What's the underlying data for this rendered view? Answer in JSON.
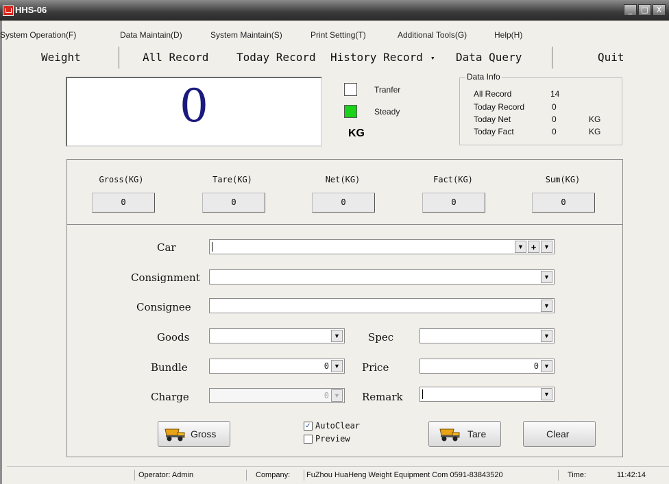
{
  "window": {
    "title": "HHS-06",
    "minimize": "_",
    "restore": "□",
    "close": "X"
  },
  "menu": [
    "System Operation(F)",
    "Data Maintain(D)",
    "System Maintain(S)",
    "Print Setting(T)",
    "Additional Tools(G)",
    "Help(H)"
  ],
  "toolbar": {
    "weight": "Weight",
    "all_record": "All Record",
    "today_record": "Today Record",
    "history_record": "History Record",
    "history_arrow": "▾",
    "data_query": "Data Query",
    "quit": "Quit"
  },
  "display": {
    "value": "0",
    "unit": "KG",
    "transfer_label": "Tranfer",
    "steady_label": "Steady",
    "steady_color": "#19d219"
  },
  "data_info": {
    "title": "Data Info",
    "rows": [
      {
        "label": "All Record",
        "value": "14",
        "unit": ""
      },
      {
        "label": "Today Record",
        "value": "0",
        "unit": ""
      },
      {
        "label": "Today Net",
        "value": "0",
        "unit": "KG"
      },
      {
        "label": "Today Fact",
        "value": "0",
        "unit": "KG"
      }
    ]
  },
  "summary": [
    {
      "label": "Gross(KG)",
      "value": "0"
    },
    {
      "label": "Tare(KG)",
      "value": "0"
    },
    {
      "label": "Net(KG)",
      "value": "0"
    },
    {
      "label": "Fact(KG)",
      "value": "0"
    },
    {
      "label": "Sum(KG)",
      "value": "0"
    }
  ],
  "form": {
    "car": {
      "label": "Car",
      "value": ""
    },
    "consignment": {
      "label": "Consignment",
      "value": ""
    },
    "consignee": {
      "label": "Consignee",
      "value": ""
    },
    "goods": {
      "label": "Goods",
      "value": ""
    },
    "spec": {
      "label": "Spec",
      "value": ""
    },
    "bundle": {
      "label": "Bundle",
      "value": "0"
    },
    "price": {
      "label": "Price",
      "value": "0"
    },
    "charge": {
      "label": "Charge",
      "value": "0"
    },
    "remark": {
      "label": "Remark",
      "value": ""
    }
  },
  "buttons": {
    "gross": "Gross",
    "tare": "Tare",
    "clear": "Clear",
    "plus": "+",
    "arrow": "▼"
  },
  "options": {
    "autoclear": {
      "label": "AutoClear",
      "checked": "✓"
    },
    "preview": {
      "label": "Preview"
    }
  },
  "status": {
    "operator": "Operator: Admin",
    "company_label": "Company:",
    "company": "FuZhou HuaHeng Weight Equipment Com 0591-83843520",
    "time_label": "Time:",
    "time": "11:42:14"
  }
}
